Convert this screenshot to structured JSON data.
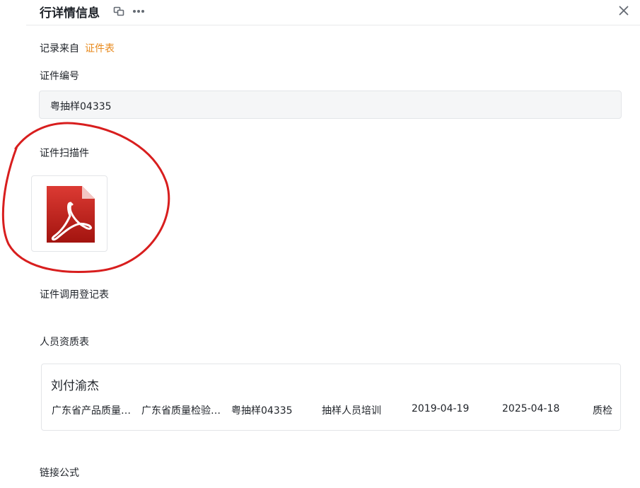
{
  "header": {
    "title": "行详情信息"
  },
  "record_source": {
    "label": "记录来自",
    "link": "证件表"
  },
  "fields": {
    "cert_number_label": "证件编号",
    "cert_number_value": "粤抽样04335",
    "cert_scan_label": "证件扫描件",
    "cert_usage_label": "证件调用登记表",
    "personnel_label": "人员资质表",
    "link_formula_label": "链接公式"
  },
  "personnel_card": {
    "name": "刘付渝杰",
    "cells": [
      "广东省产品质量监督检验研究院",
      "广东省质量检验协会",
      "粤抽样04335",
      "抽样人员培训",
      "2019-04-19",
      "2025-04-18",
      "质检"
    ]
  },
  "colors": {
    "accent_link": "#e88a1d",
    "annotation": "#d81e1e",
    "pdf_red": "#c0221e"
  },
  "icons": {
    "attachment": "pdf-file-icon",
    "header_actions": [
      "copy-icon",
      "more-icon",
      "close-icon"
    ]
  }
}
